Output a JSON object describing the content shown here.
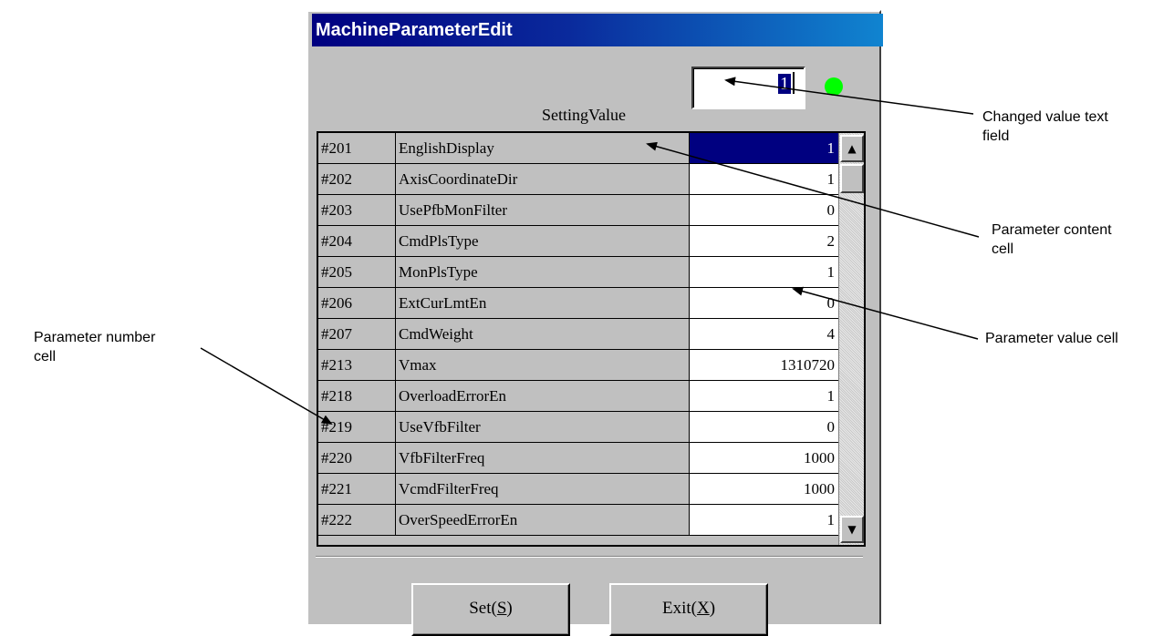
{
  "window": {
    "title": "MachineParameterEdit"
  },
  "setting": {
    "label": "SettingValue",
    "value": "1",
    "status_color": "#00ff00"
  },
  "table": {
    "rows": [
      {
        "num": "#201",
        "name": "EnglishDisplay",
        "value": "1"
      },
      {
        "num": "#202",
        "name": "AxisCoordinateDir",
        "value": "1"
      },
      {
        "num": "#203",
        "name": "UsePfbMonFilter",
        "value": "0"
      },
      {
        "num": "#204",
        "name": "CmdPlsType",
        "value": "2"
      },
      {
        "num": "#205",
        "name": "MonPlsType",
        "value": "1"
      },
      {
        "num": "#206",
        "name": "ExtCurLmtEn",
        "value": "0"
      },
      {
        "num": "#207",
        "name": "CmdWeight",
        "value": "4"
      },
      {
        "num": "#213",
        "name": "Vmax",
        "value": "1310720"
      },
      {
        "num": "#218",
        "name": "OverloadErrorEn",
        "value": "1"
      },
      {
        "num": "#219",
        "name": "UseVfbFilter",
        "value": "0"
      },
      {
        "num": "#220",
        "name": "VfbFilterFreq",
        "value": "1000"
      },
      {
        "num": "#221",
        "name": "VcmdFilterFreq",
        "value": "1000"
      },
      {
        "num": "#222",
        "name": "OverSpeedErrorEn",
        "value": "1"
      }
    ],
    "selected_index": 0
  },
  "buttons": {
    "set": {
      "text": "Set(",
      "key": "S",
      "close": ")"
    },
    "exit": {
      "text": "Exit(",
      "key": "X",
      "close": ")"
    }
  },
  "annotations": {
    "changed_value": [
      "Changed value text",
      "field"
    ],
    "content_cell": [
      "Parameter content",
      "cell"
    ],
    "value_cell": [
      "Parameter value cell"
    ],
    "number_cell": [
      "Parameter number",
      "cell"
    ]
  }
}
